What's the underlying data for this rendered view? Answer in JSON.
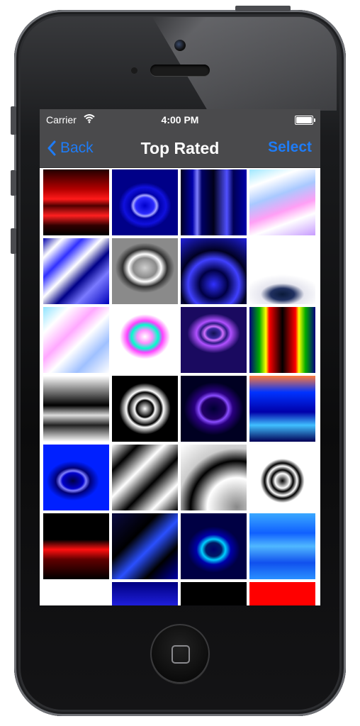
{
  "status_bar": {
    "carrier": "Carrier",
    "time": "4:00 PM"
  },
  "nav": {
    "back_label": "Back",
    "title": "Top Rated",
    "select_label": "Select"
  },
  "colors": {
    "accent": "#1e7cf7",
    "bar": "#4a4a4c"
  },
  "thumbnails": [
    {
      "name": "red-wave",
      "style": "linear-gradient(180deg,#220000 0%,#b30000 30%,#ff1a1a 45%,#500000 55%,#ff2020 70%,#300000 85%,#000 100%)"
    },
    {
      "name": "blue-oval",
      "style": "radial-gradient(ellipse 40% 35% at 50% 55%,#0000cc 0%,#2b2bff 35%,#a8a8ff 45%,#0000aa 55%,#1010dd 80%,#000088 100%)"
    },
    {
      "name": "blue-vertical-bands",
      "style": "linear-gradient(90deg,#000022 0%,#0000aa 18%,#7f7fff 25%,#000066 32%,#00001a 50%,#5050ff 70%,#000055 80%,#0000aa 100%)"
    },
    {
      "name": "pastel-waves",
      "style": "linear-gradient(160deg,#9fe8ff 0%,#ffffff 20%,#a9c9ff 40%,#ff9ff5 60%,#ffffff 75%,#c79bff 100%)"
    },
    {
      "name": "blue-white-swirl",
      "style": "linear-gradient(135deg,#0000aa 0%,#ffffff 15%,#3030ff 30%,#ffffff 45%,#000088 60%,#7a7aff 75%,#0000bb 100%)"
    },
    {
      "name": "gray-blob",
      "style": "radial-gradient(ellipse 45% 38% at 50% 45%,#cfcfcf 0%,#8a8a8a 40%,#ffffff 55%,#303030 75%,#8a8a8a 100%)"
    },
    {
      "name": "blue-dark-drops",
      "style": "radial-gradient(circle at 50% 70%,#3030ff 0%,#000044 25%,#4040ff 45%,#000022 60%,#2020dd 100%)"
    },
    {
      "name": "white-navy-blob",
      "style": "radial-gradient(ellipse 60% 30% at 50% 85%,#0a1a3a 0%,#203060 30%,#e6e6ef 55%,#ffffff 100%)"
    },
    {
      "name": "pastel-ripples",
      "style": "linear-gradient(135deg,#8fe3ff 0%,#ffffff 20%,#ffa8ff 40%,#ffffff 55%,#9fc0ff 75%,#ffffff 100%)"
    },
    {
      "name": "neon-oval",
      "style": "radial-gradient(ellipse 45% 40% at 50% 45%,#ffffff 0%,#ff8fff 25%,#00ffcc 45%,#ff40ff 60%,#ffffff 85%)"
    },
    {
      "name": "purple-ovals",
      "style": "radial-gradient(ellipse 40% 30% at 50% 40%,#101050 0%,#3a2aa0 25%,#d070ff 35%,#2a1a80 50%,#b050ff 65%,#1a0a60 100%)"
    },
    {
      "name": "rainbow-arches",
      "style": "linear-gradient(90deg,#000080 0%,#00aa00 15%,#ffff00 25%,#ff0000 30%,#000000 50%,#ff0000 70%,#ffff00 75%,#00aa00 85%,#000080 100%)"
    },
    {
      "name": "bw-layers",
      "style": "linear-gradient(180deg,#ffffff 0%,#555555 30%,#000000 45%,#dddddd 60%,#222222 75%,#ffffff 100%)"
    },
    {
      "name": "bw-rings",
      "style": "radial-gradient(circle at 50% 50%,#ffffff 0%,#000000 18%,#ffffff 22%,#000000 35%,#ffffff 40%,#000000 55%,#000000 100%)"
    },
    {
      "name": "violet-ring",
      "style": "radial-gradient(ellipse 45% 40% at 50% 50%,#000033 0%,#220066 40%,#8a4dff 50%,#2a0080 65%,#000022 100%)"
    },
    {
      "name": "blue-orange-drip",
      "style": "linear-gradient(180deg,#ff7a3a 0%,#0033ff 25%,#0000aa 55%,#40c0ff 75%,#000055 100%)"
    },
    {
      "name": "blue-whirl",
      "style": "radial-gradient(ellipse 40% 30% at 45% 55%,#000044 0%,#0000cc 40%,#8080ff 50%,#000077 65%,#0020ff 100%)"
    },
    {
      "name": "bw-blobs",
      "style": "linear-gradient(135deg,#ffffff 0%,#000000 20%,#ffffff 40%,#000000 60%,#ffffff 80%,#000000 100%)"
    },
    {
      "name": "gray-tire",
      "style": "radial-gradient(circle at 85% 95%,#888888 0%,#ffffff 35%,#000000 55%,#cccccc 70%,#ffffff 100%)"
    },
    {
      "name": "white-knot",
      "style": "radial-gradient(circle at 50% 55%,#000000 0%,#ffffff 15%,#000000 22%,#ffffff 30%,#000000 36%,#ffffff 45%)"
    },
    {
      "name": "black-red-fringe",
      "style": "linear-gradient(180deg,#000000 0%,#000000 40%,#ff1010 55%,#600000 70%,#000000 100%)"
    },
    {
      "name": "blue-black-blob",
      "style": "linear-gradient(135deg,#0a0a40 0%,#000000 35%,#2a50ff 55%,#000000 75%,#0000aa 100%)"
    },
    {
      "name": "cyan-oval",
      "style": "radial-gradient(ellipse 40% 35% at 50% 55%,#000066 0%,#001a66 30%,#00d0ff 45%,#0000aa 65%,#000044 100%)"
    },
    {
      "name": "blue-lines",
      "style": "linear-gradient(180deg,#3aa8ff 0%,#1060ff 30%,#50b8ff 50%,#1050ee 75%,#2a90ff 100%)"
    },
    {
      "name": "bw-swirl",
      "style": "radial-gradient(circle at 50% 80%,#000000 0%,#ffffff 20%,#000000 30%,#ffffff 45%)"
    },
    {
      "name": "blue-cap",
      "style": "linear-gradient(180deg,#000080 0%,#2a2aff 50%,#ffffff 51%,#ffffff 100%)"
    },
    {
      "name": "black-white-dome",
      "style": "radial-gradient(ellipse 60% 40% at 50% 100%,#ffffff 0%,#ffffff 45%,#000000 50%,#000000 100%)"
    },
    {
      "name": "red-black-swirl",
      "style": "linear-gradient(180deg,#ff0000 0%,#ff0000 40%,#000000 55%,#ff0000 70%,#000000 100%)"
    }
  ]
}
